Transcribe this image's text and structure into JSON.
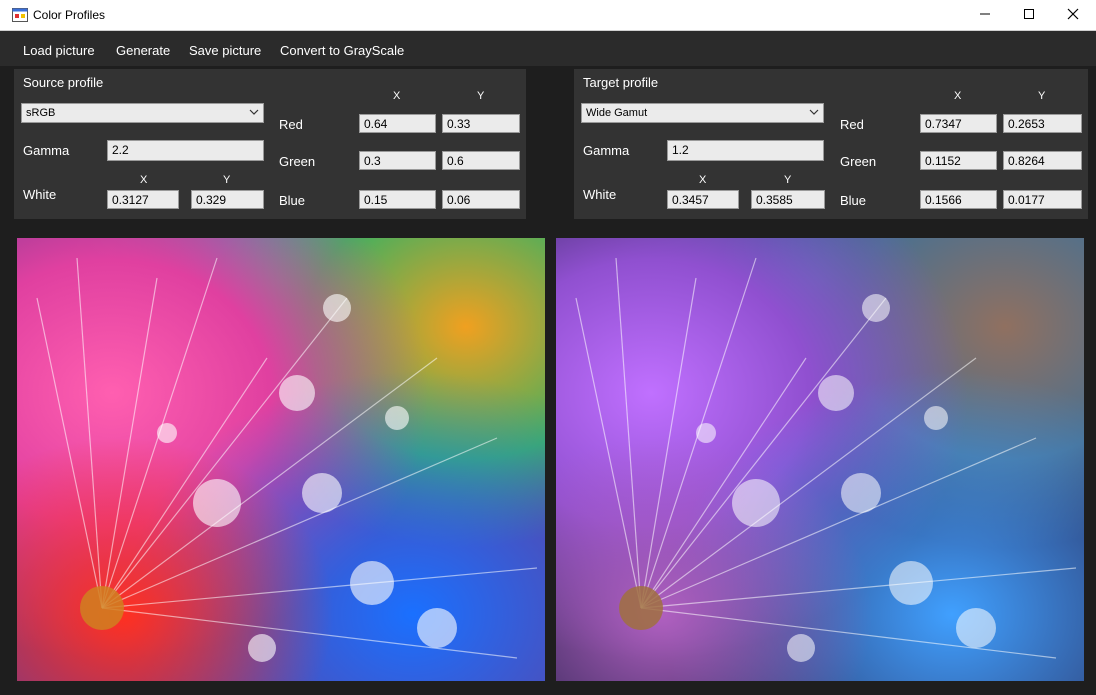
{
  "window": {
    "title": "Color Profiles"
  },
  "menu": {
    "load_picture": "Load picture",
    "generate": "Generate",
    "save_picture": "Save picture",
    "convert_grayscale": "Convert to GrayScale"
  },
  "labels": {
    "x": "X",
    "y": "Y",
    "red": "Red",
    "green": "Green",
    "blue": "Blue",
    "gamma": "Gamma",
    "white": "White"
  },
  "source": {
    "title": "Source profile",
    "profile": "sRGB",
    "gamma": "2.2",
    "white_x": "0.3127",
    "white_y": "0.329",
    "red_x": "0.64",
    "red_y": "0.33",
    "green_x": "0.3",
    "green_y": "0.6",
    "blue_x": "0.15",
    "blue_y": "0.06"
  },
  "target": {
    "title": "Target profile",
    "profile": "Wide Gamut",
    "gamma": "1.2",
    "white_x": "0.3457",
    "white_y": "0.3585",
    "red_x": "0.7347",
    "red_y": "0.2653",
    "green_x": "0.1152",
    "green_y": "0.8264",
    "blue_x": "0.1566",
    "blue_y": "0.0177"
  },
  "icons": {
    "app": "app-window-icon",
    "minimize": "minimize-icon",
    "maximize": "maximize-icon",
    "close": "close-icon",
    "dropdown": "chevron-down-icon"
  },
  "colors": {
    "background": "#1e1e1e",
    "menubar": "#2b2b2b",
    "panel": "#333333",
    "field": "#ebebeb"
  }
}
